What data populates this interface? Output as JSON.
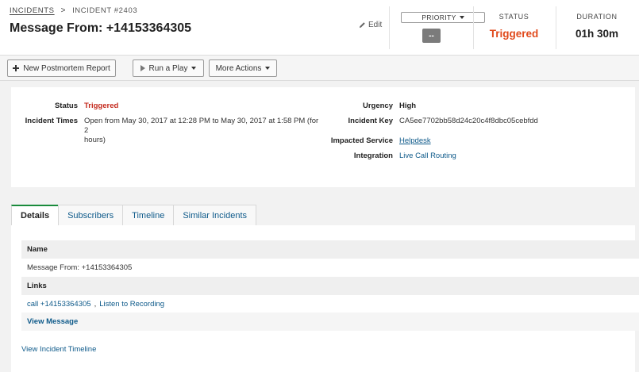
{
  "breadcrumb": {
    "incidents": "INCIDENTS",
    "separator": ">",
    "current": "INCIDENT #2403"
  },
  "title": "Message From: +14153364305",
  "edit_label": "Edit",
  "priority": {
    "button_label": "PRIORITY",
    "value": "--"
  },
  "status": {
    "label": "STATUS",
    "value": "Triggered",
    "color": "#e0491b"
  },
  "duration": {
    "label": "DURATION",
    "value": "01h 30m"
  },
  "toolbar": {
    "postmortem": "New Postmortem Report",
    "run_play": "Run a Play",
    "more_actions": "More Actions"
  },
  "summary": {
    "status_label": "Status",
    "status_value": "Triggered",
    "times_label": "Incident Times",
    "times_line1": "Open from May 30, 2017 at 12:28 PM to May 30, 2017 at 1:58 PM (for 2",
    "times_line2": "hours)",
    "urgency_label": "Urgency",
    "urgency_value": "High",
    "key_label": "Incident Key",
    "key_value": "CA5ee7702bb58d24c20c4f8dbc05cebfdd",
    "service_label": "Impacted Service",
    "service_value": "Helpdesk",
    "integration_label": "Integration",
    "integration_value": "Live Call Routing"
  },
  "tabs": [
    "Details",
    "Subscribers",
    "Timeline",
    "Similar Incidents"
  ],
  "details": {
    "name_header": "Name",
    "name_value": "Message From: +14153364305",
    "links_header": "Links",
    "call_link": "call +14153364305",
    "link_sep": ",",
    "recording_link": "Listen to Recording",
    "view_message": "View Message",
    "timeline_link": "View Incident Timeline"
  },
  "colors": {
    "accent_green": "#1a8b3c",
    "link_blue": "#0e5a8a",
    "triggered_red": "#c42a1e"
  }
}
